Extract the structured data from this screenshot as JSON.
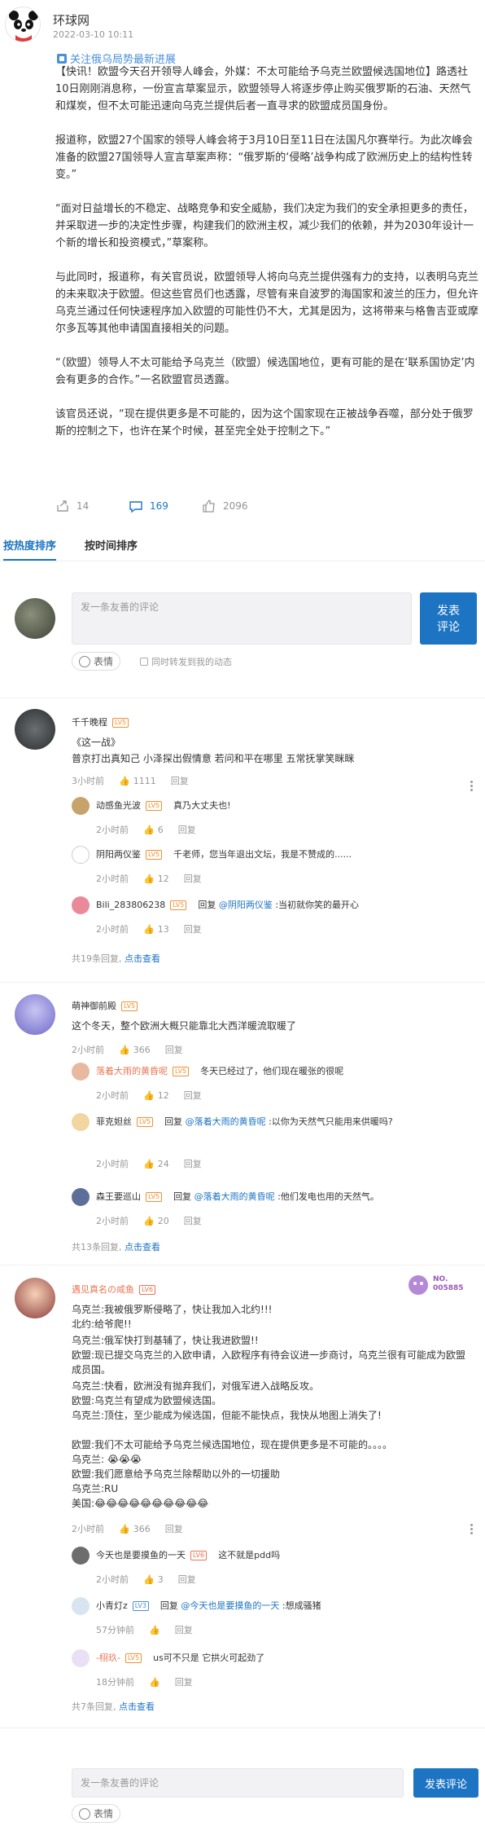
{
  "source": {
    "name": "环球网",
    "time": "2022-03-10 10:11"
  },
  "follow": {
    "label": "关注俄乌局势最新进展"
  },
  "article": {
    "paragraphs": [
      "【快讯！欧盟今天召开领导人峰会，外媒：不太可能给予乌克兰欧盟候选国地位】路透社10日刚刚消息称，一份宣言草案显示，欧盟领导人将逐步停止购买俄罗斯的石油、天然气和煤炭，但不太可能迅速向乌克兰提供后者一直寻求的欧盟成员国身份。",
      "报道称，欧盟27个国家的领导人峰会将于3月10日至11日在法国凡尔赛举行。为此次峰会准备的欧盟27国领导人宣言草案声称：“俄罗斯的‘侵略’战争构成了欧洲历史上的结构性转变。”",
      "“面对日益增长的不稳定、战略竞争和安全威胁，我们决定为我们的安全承担更多的责任，并采取进一步的决定性步骤，构建我们的欧洲主权，减少我们的依赖，并为2030年设计一个新的增长和投资模式，”草案称。",
      "与此同时，报道称，有关官员说，欧盟领导人将向乌克兰提供强有力的支持，以表明乌克兰的未来取决于欧盟。但这些官员们也透露，尽管有来自波罗的海国家和波兰的压力，但允许乌克兰通过任何快速程序加入欧盟的可能性仍不大，尤其是因为，这将带来与格鲁吉亚或摩尔多瓦等其他申请国直接相关的问题。",
      "“（欧盟）领导人不太可能给予乌克兰（欧盟）候选国地位，更有可能的是在‘联系国协定’内会有更多的合作。”一名欧盟官员透露。",
      "该官员还说，“现在提供更多是不可能的，因为这个国家现在正被战争吞噬，部分处于俄罗斯的控制之下，也许在某个时候，甚至完全处于控制之下。”"
    ]
  },
  "actions": {
    "repost": "14",
    "comments": "169",
    "likes": "2096"
  },
  "tabs": [
    "按热度排序",
    "按时间排序"
  ],
  "composer": {
    "placeholder": "发一条友善的评论",
    "send": "发表评论",
    "emoji": "表情",
    "sync": "同时转发到我的动态"
  },
  "threads": [
    {
      "user": "千千晚程",
      "level": "LV5",
      "text_lines": [
        "《这一战》",
        "普京打出真知己 小泽探出假情意 若问和平在哪里 五常抚掌笑眯眯"
      ],
      "time": "3小时前",
      "likes": "1111",
      "reply_label": "回复",
      "replies": [
        {
          "user": "动感鱼光波",
          "level": "LV5",
          "prefix": "",
          "at": "",
          "text": "真乃大丈夫也!",
          "time": "2小时前",
          "likes": "6",
          "reply_label": "回复"
        },
        {
          "user": "阴阳两仪鉴",
          "level": "LV5",
          "prefix": "",
          "at": "",
          "text": "千老师，您当年退出文坛，我是不赞成的......",
          "time": "2小时前",
          "likes": "12",
          "reply_label": "回复"
        },
        {
          "user": "Bili_283806238",
          "level": "LV5",
          "prefix": "回复 ",
          "at": "@阴阳两仪鉴",
          "text": " :当初就你笑的最开心",
          "time": "2小时前",
          "likes": "13",
          "reply_label": "回复"
        }
      ],
      "more": {
        "text": "共19条回复, ",
        "link": "点击查看"
      }
    },
    {
      "user": "萌神御前殿",
      "level": "LV5",
      "text_lines": [
        "这个冬天，整个欧洲大概只能靠北大西洋暖流取暖了"
      ],
      "time": "2小时前",
      "likes": "366",
      "reply_label": "回复",
      "replies": [
        {
          "user": "落着大雨的黄昏呢",
          "level": "LV5",
          "prefix": "",
          "at": "",
          "text": "冬天已经过了，他们现在暖张的很呢",
          "time": "2小时前",
          "likes": "12",
          "reply_label": "回复"
        },
        {
          "user": "菲克妲丝",
          "level": "LV5",
          "prefix": "回复 ",
          "at": "@落着大雨的黄昏呢",
          "text": " :以你为天然气只能用来供暖吗?",
          "time": "2小时前",
          "likes": "24",
          "reply_label": "回复"
        },
        {
          "user": "森王要巡山",
          "level": "LV5",
          "prefix": "回复 ",
          "at": "@落着大雨的黄昏呢",
          "text": " :他们发电也用的天然气。",
          "time": "2小时前",
          "likes": "20",
          "reply_label": "回复"
        }
      ],
      "more": {
        "text": "共13条回复, ",
        "link": "点击查看"
      }
    },
    {
      "user": "遇见真名の咸鱼",
      "level": "LV6",
      "stamp_label": "NO.",
      "stamp_number": "005885",
      "text_lines": [
        "乌克兰:我被俄罗斯侵略了，快让我加入北约!!!",
        "北约:给爷爬!!",
        "乌克兰:俄军快打到基辅了，快让我进欧盟!!",
        "欧盟:现已提交乌克兰的入欧申请，入欧程序有待会议进一步商讨，乌克兰很有可能成为欧盟成员国。",
        "乌克兰:快看，欧洲没有抛弃我们，对俄军进入战略反攻。",
        "欧盟:乌克兰有望成为欧盟候选国。",
        "乌克兰:顶住，至少能成为候选国，但能不能快点，我快从地图上消失了!",
        "欧盟:我们不太可能给予乌克兰候选国地位，现在提供更多是不可能的。。。。",
        "乌克兰:",
        "欧盟:我们愿意给予乌克兰除帮助以外的一切援助",
        "乌克兰:RU",
        "美国:"
      ],
      "time": "2小时前",
      "likes": "366",
      "reply_label": "回复",
      "replies": [
        {
          "user": "今天也是要摸鱼的一天",
          "level": "LV6",
          "prefix": "",
          "at": "",
          "text": "这不就是pdd吗",
          "time": "2小时前",
          "likes": "3",
          "reply_label": "回复"
        },
        {
          "user": "小青灯z",
          "level": "LV3",
          "prefix": "回复 ",
          "at": "@今天也是要摸鱼的一天",
          "text": " :想成骚猪",
          "time": "57分钟前",
          "likes": "",
          "reply_label": "回复"
        },
        {
          "user": "-栩玖-",
          "level": "LV5",
          "prefix": "",
          "at": "",
          "text": "us可不只是 它拱火可起劲了",
          "time": "18分钟前",
          "likes": "",
          "reply_label": "回复"
        }
      ],
      "more": {
        "text": "共7条回复, ",
        "link": "点击查看"
      }
    }
  ]
}
